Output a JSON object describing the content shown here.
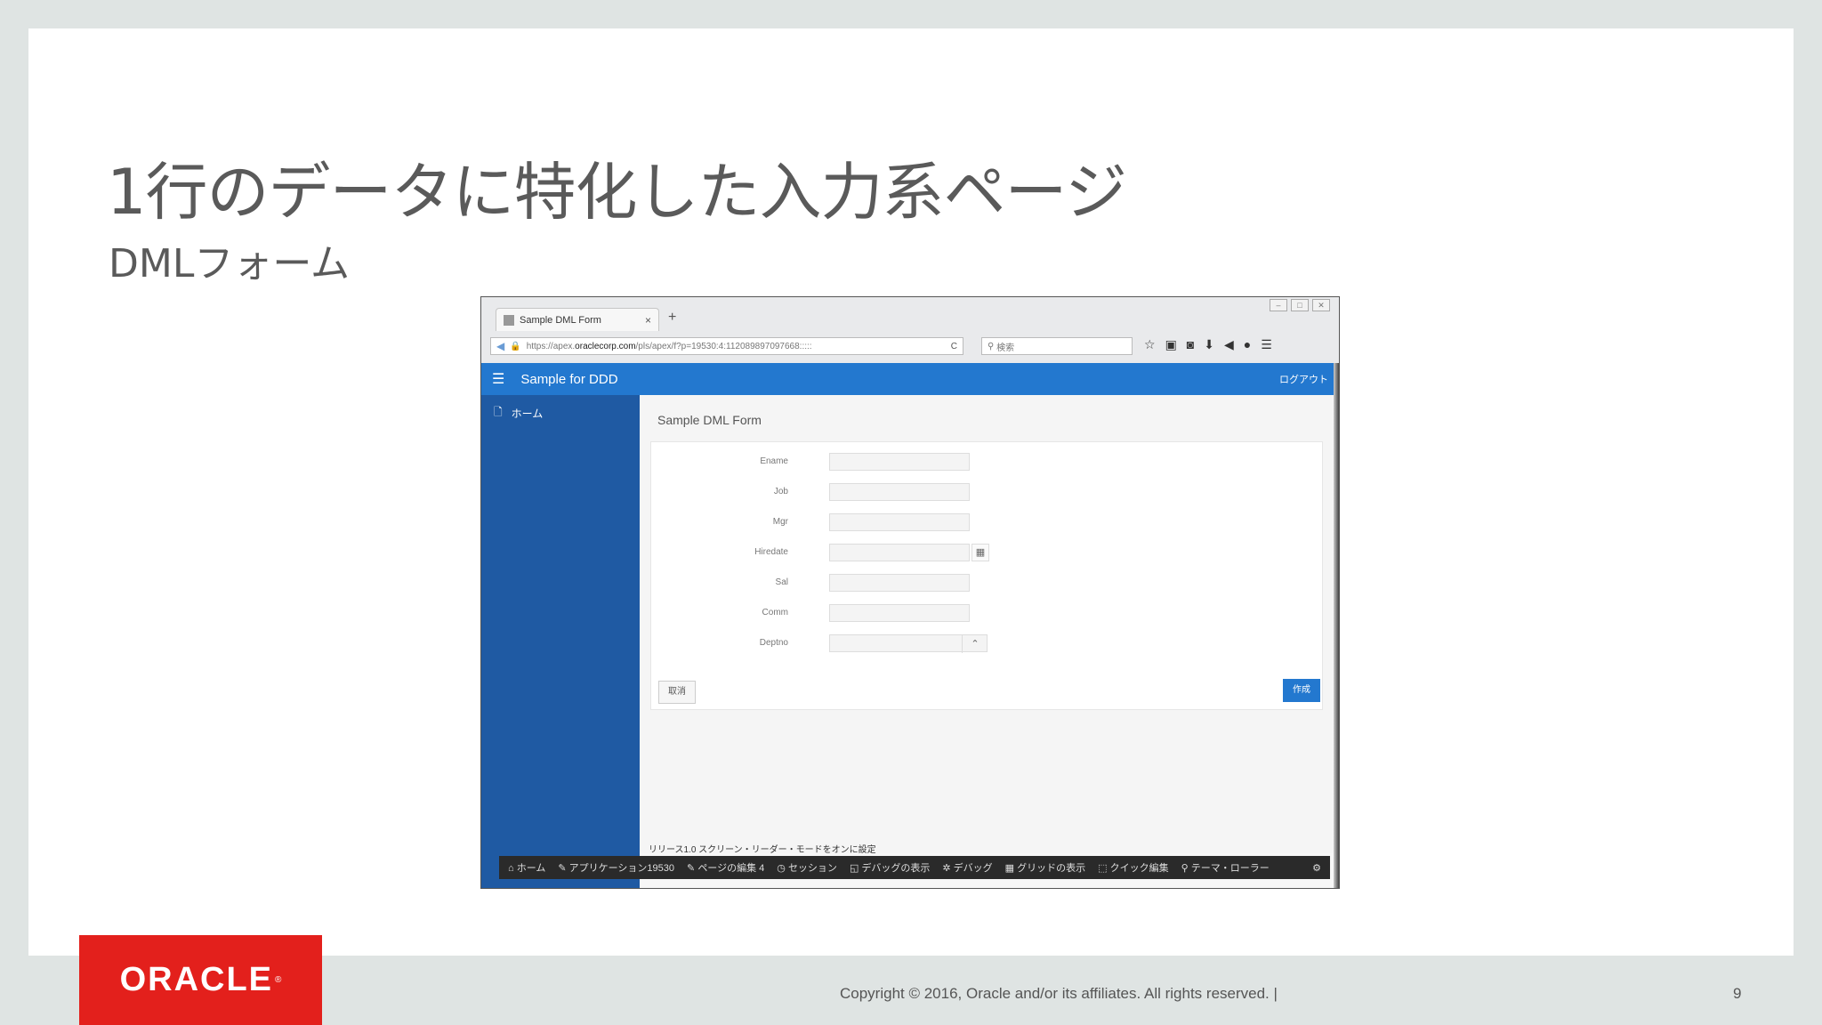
{
  "slide": {
    "title": "1行のデータに特化した入力系ページ",
    "subtitle": "DMLフォーム",
    "logo_text": "ORACLE",
    "copyright": "Copyright © 2016, Oracle and/or its affiliates. All rights reserved.  |",
    "page_number": "9",
    "accent_color": "#e3201c"
  },
  "browser": {
    "tab_title": "Sample DML Form",
    "tab_close": "×",
    "new_tab": "+",
    "url_prefix": "https://apex.",
    "url_domain": "oraclecorp.com",
    "url_path": "/pls/apex/f?p=19530:4:112089897097668:::::",
    "search_placeholder": "検索",
    "reload": "C"
  },
  "app": {
    "name": "Sample for DDD",
    "logout": "ログアウト",
    "nav_home": "ホーム",
    "region_title": "Sample DML Form",
    "fields": [
      {
        "label": "Ename"
      },
      {
        "label": "Job"
      },
      {
        "label": "Mgr"
      },
      {
        "label": "Hiredate"
      },
      {
        "label": "Sal"
      },
      {
        "label": "Comm"
      },
      {
        "label": "Deptno"
      }
    ],
    "cancel_label": "取消",
    "create_label": "作成",
    "brand_color": "#2378cf"
  },
  "devbar": {
    "release": "リリース1.0  スクリーン・リーダー・モードをオンに設定",
    "home": "ホーム",
    "application": "アプリケーション19530",
    "edit_page": "ページの編集 4",
    "session": "セッション",
    "view_debug": "デバッグの表示",
    "debug": "デバッグ",
    "show_grid": "グリッドの表示",
    "quick_edit": "クイック編集",
    "theme_roller": "テーマ・ローラー"
  }
}
